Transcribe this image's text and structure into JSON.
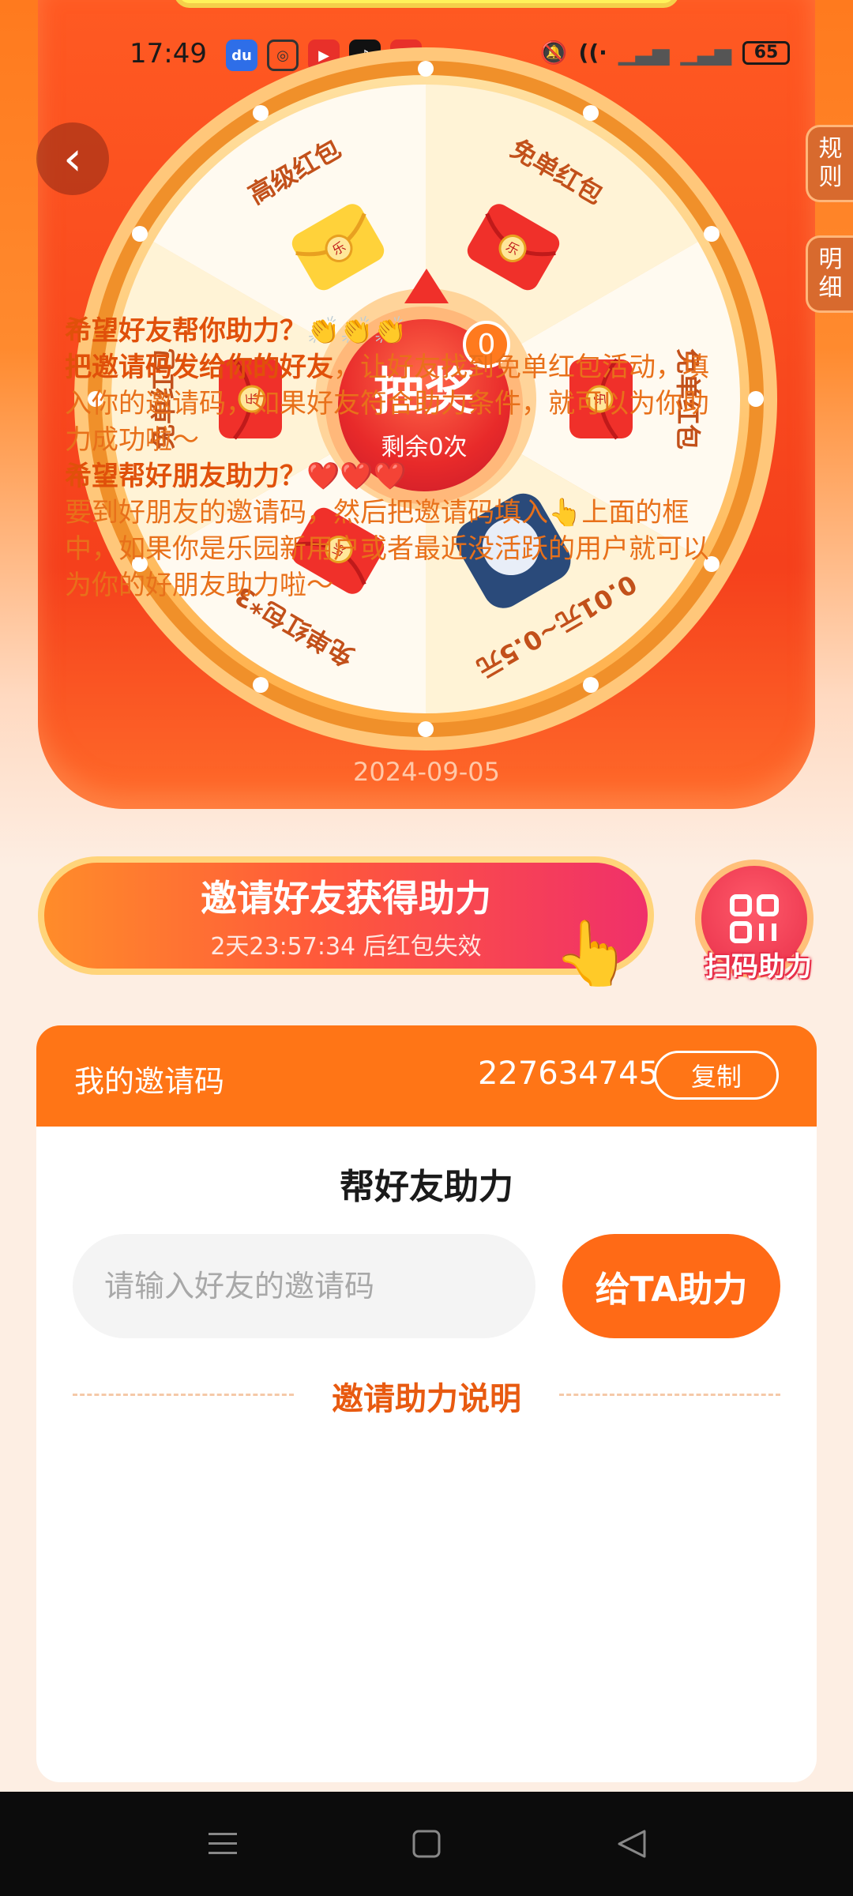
{
  "status_bar": {
    "time": "17:49",
    "app_icons": [
      "baidu-icon",
      "camera-icon",
      "video-icon",
      "tiktok-icon",
      "toutiao-icon"
    ],
    "toutiao_label": "头条",
    "battery": "65"
  },
  "side_tabs": [
    {
      "label_1": "规",
      "label_2": "则"
    },
    {
      "label_1": "明",
      "label_2": "细"
    }
  ],
  "wheel": {
    "prizes": [
      "免单红包",
      "免单红包",
      "0.01元~0.5元",
      "免单红包*3",
      "免单红包",
      "高级红包"
    ],
    "envelope_mark": "乐",
    "spin_label": "抽奖",
    "remaining_label": "剩余0次",
    "badge_count": "0",
    "date": "2024-09-05"
  },
  "invite": {
    "title": "邀请好友获得助力",
    "countdown": "2天23:57:34 后红包失效",
    "scan_label": "扫码助力"
  },
  "invite_code": {
    "label": "我的邀请码",
    "value": "227634745",
    "copy_label": "复制"
  },
  "help": {
    "title": "帮好友助力",
    "input_placeholder": "请输入好友的邀请码",
    "assist_button": "给TA助力",
    "explain_title": "邀请助力说明",
    "line1": "希望好友帮你助力？👏👏👏",
    "line2_bold": "把邀请码发给你的好友",
    "line2_rest": "，让好友找到免单红包活动，填入你的邀请码，如果好友符合助力条件，就可以为你助力成功啦～",
    "line3": "希望帮好朋友助力？❤️❤️❤️",
    "line4": "要到好朋友的邀请码，然后把邀请码填入👆上面的框中，如果你是乐园新用户或者最近没活跃的用户就可以为你的好朋友助力啦～"
  },
  "colors": {
    "accent": "#ff7516",
    "wheel_red": "#f5401c",
    "text_orange": "#e8701a"
  }
}
